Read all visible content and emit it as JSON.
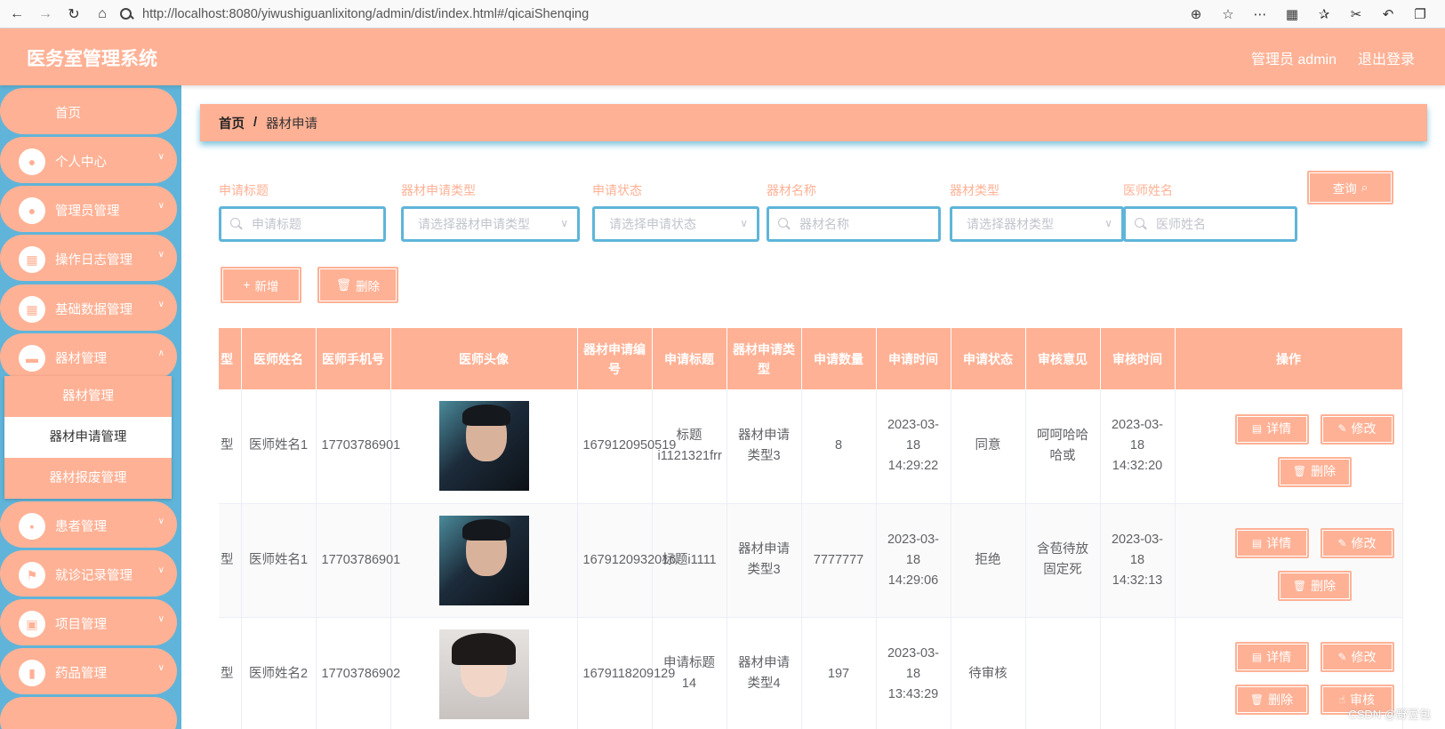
{
  "browser": {
    "url": "http://localhost:8080/yiwushiguanlixitong/admin/dist/index.html#/qicaiShenqing"
  },
  "header": {
    "title": "医务室管理系统",
    "user_label": "管理员 admin",
    "logout_label": "退出登录"
  },
  "sidebar": {
    "items": [
      {
        "label": "首页"
      },
      {
        "label": "个人中心"
      },
      {
        "label": "管理员管理"
      },
      {
        "label": "操作日志管理"
      },
      {
        "label": "基础数据管理"
      },
      {
        "label": "器材管理"
      },
      {
        "label": "患者管理"
      },
      {
        "label": "就诊记录管理"
      },
      {
        "label": "项目管理"
      },
      {
        "label": "药品管理"
      }
    ],
    "submenu": [
      {
        "label": "器材管理"
      },
      {
        "label": "器材申请管理"
      },
      {
        "label": "器材报废管理"
      }
    ]
  },
  "breadcrumb": {
    "home": "首页",
    "separator": "/",
    "current": "器材申请"
  },
  "filters": {
    "title": {
      "label": "申请标题",
      "placeholder": "申请标题"
    },
    "apply_type": {
      "label": "器材申请类型",
      "placeholder": "请选择器材申请类型"
    },
    "status": {
      "label": "申请状态",
      "placeholder": "请选择申请状态"
    },
    "equipment_name": {
      "label": "器材名称",
      "placeholder": "器材名称"
    },
    "equipment_type": {
      "label": "器材类型",
      "placeholder": "请选择器材类型"
    },
    "doctor_name": {
      "label": "医师姓名",
      "placeholder": "医师姓名"
    },
    "search_label": "查询"
  },
  "actions": {
    "add_label": "新增",
    "delete_label": "删除"
  },
  "table": {
    "columns": [
      "型",
      "医师姓名",
      "医师手机号",
      "医师头像",
      "器材申请编号",
      "申请标题",
      "器材申请类型",
      "申请数量",
      "申请时间",
      "申请状态",
      "审核意见",
      "审核时间",
      "操作"
    ],
    "rows": [
      {
        "type": "型",
        "doctor": "医师姓名1",
        "phone": "17703786901",
        "avatar": "male",
        "code": "1679120950519",
        "title": "标题i1121321frr",
        "apply_type": "器材申请类型3",
        "qty": "8",
        "time": "2023-03-18 14:29:22",
        "status": "同意",
        "opinion": "呵呵哈哈哈或",
        "review_time": "2023-03-18 14:32:20"
      },
      {
        "type": "型",
        "doctor": "医师姓名1",
        "phone": "17703786901",
        "avatar": "male",
        "code": "1679120932016",
        "title": "标题i1111",
        "apply_type": "器材申请类型3",
        "qty": "7777777",
        "time": "2023-03-18 14:29:06",
        "status": "拒绝",
        "opinion": "含苞待放固定死",
        "review_time": "2023-03-18 14:32:13"
      },
      {
        "type": "型",
        "doctor": "医师姓名2",
        "phone": "17703786902",
        "avatar": "female",
        "code": "1679118209129",
        "title": "申请标题14",
        "apply_type": "器材申请类型4",
        "qty": "197",
        "time": "2023-03-18 13:43:29",
        "status": "待审核",
        "opinion": "",
        "review_time": ""
      }
    ],
    "op_labels": {
      "detail": "详情",
      "edit": "修改",
      "delete": "删除",
      "audit": "审核"
    }
  },
  "watermark": "CSDN @野豆包",
  "colors": {
    "accent": "#ffb195",
    "sidebar_bg": "#60b4d9",
    "border_blue": "#5fb5d8"
  }
}
